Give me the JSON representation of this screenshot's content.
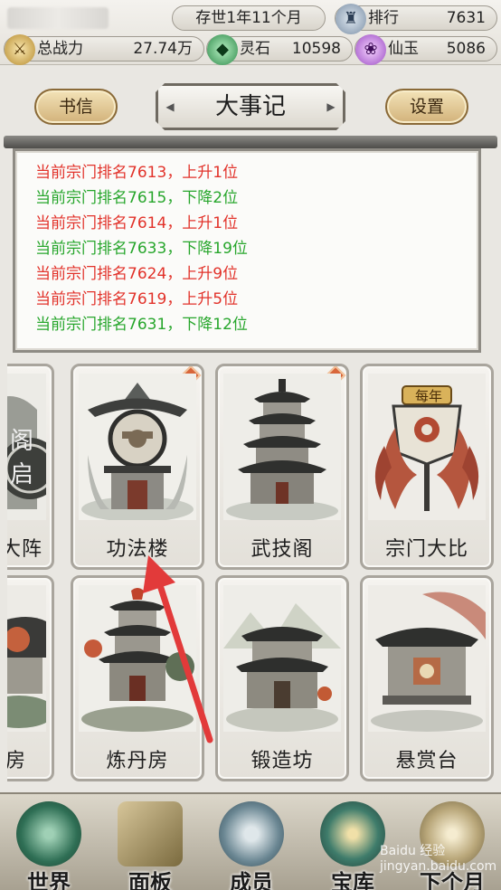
{
  "top_bar": {
    "game_time": "存世1年11个月",
    "rank": {
      "label": "排行",
      "value": "7631",
      "icon": "rank-icon"
    },
    "power": {
      "label": "总战力",
      "value": "27.74万",
      "icon": "power-icon"
    },
    "spirit_stone": {
      "label": "灵石",
      "value": "10598",
      "icon": "spirit-stone-icon"
    },
    "immortal_jade": {
      "label": "仙玉",
      "value": "5086",
      "icon": "immortal-jade-icon"
    }
  },
  "header": {
    "letter_button": "书信",
    "title": "大事记",
    "settings_button": "设置"
  },
  "log": {
    "lines": [
      {
        "text": "当前宗门排名7613，上升1位",
        "color": "#e2322a"
      },
      {
        "text": "当前宗门排名7615，下降2位",
        "color": "#27a62c"
      },
      {
        "text": "当前宗门排名7614，上升1位",
        "color": "#e2322a"
      },
      {
        "text": "当前宗门排名7633，下降19位",
        "color": "#27a62c"
      },
      {
        "text": "当前宗门排名7624，上升9位",
        "color": "#e2322a"
      },
      {
        "text": "当前宗门排名7619，上升5位",
        "color": "#e2322a"
      },
      {
        "text": "当前宗门排名7631，下降12位",
        "color": "#27a62c"
      }
    ]
  },
  "buildings": {
    "row1": [
      {
        "name": "大阵",
        "art_text": "阁启",
        "badge": false
      },
      {
        "name": "功法楼",
        "badge": true
      },
      {
        "name": "武技阁",
        "badge": true
      },
      {
        "name": "宗门大比",
        "banner": "每年",
        "badge": false
      }
    ],
    "row2": [
      {
        "name": "房",
        "badge": false
      },
      {
        "name": "炼丹房",
        "badge": false
      },
      {
        "name": "锻造坊",
        "badge": false
      },
      {
        "name": "悬赏台",
        "badge": false
      }
    ]
  },
  "bottom_nav": [
    {
      "label": "世界",
      "icon": "world-icon"
    },
    {
      "label": "面板",
      "icon": "panel-icon"
    },
    {
      "label": "成员",
      "icon": "member-icon"
    },
    {
      "label": "宝库",
      "icon": "treasury-icon"
    },
    {
      "label": "下个月",
      "icon": "next-month-icon"
    }
  ],
  "watermark": "Baidu 经验 jingyan.baidu.com",
  "colors": {
    "rank_up": "#e2322a",
    "rank_down": "#27a62c",
    "annotation_arrow": "#e23a3a"
  }
}
